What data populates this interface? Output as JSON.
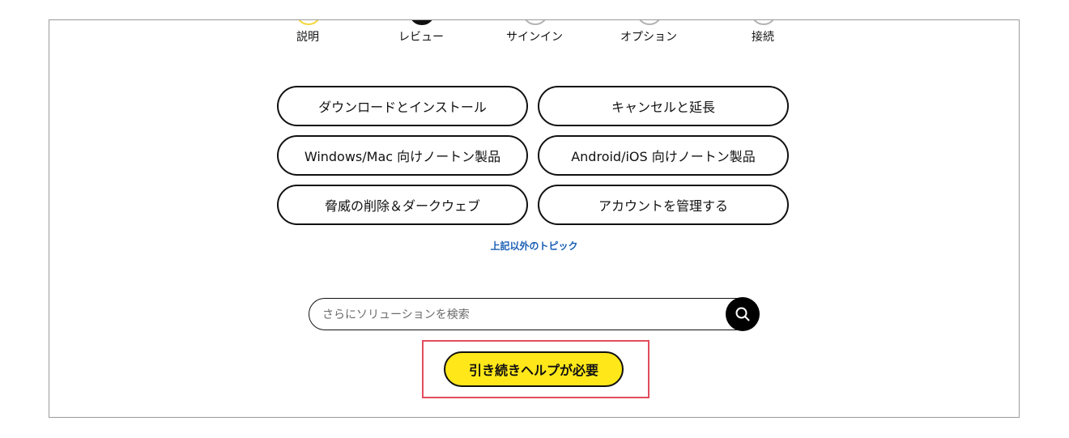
{
  "steps": [
    {
      "label": "説明",
      "state": "done"
    },
    {
      "label": "レビュー",
      "state": "current"
    },
    {
      "label": "サインイン",
      "state": "pending"
    },
    {
      "label": "オプション",
      "state": "pending"
    },
    {
      "label": "接続",
      "state": "pending"
    }
  ],
  "topics": [
    "ダウンロードとインストール",
    "キャンセルと延長",
    "Windows/Mac 向けノートン製品",
    "Android/iOS 向けノートン製品",
    "脅威の削除＆ダークウェブ",
    "アカウントを管理する"
  ],
  "other_topics_link": "上記以外のトピック",
  "search": {
    "placeholder": "さらにソリューションを検索",
    "value": "",
    "button_icon": "search-icon"
  },
  "help_button": "引き続きヘルプが必要",
  "colors": {
    "accent_yellow": "#ffe71a",
    "link_blue": "#1a5fb4",
    "highlight_red": "#e24d5c"
  }
}
